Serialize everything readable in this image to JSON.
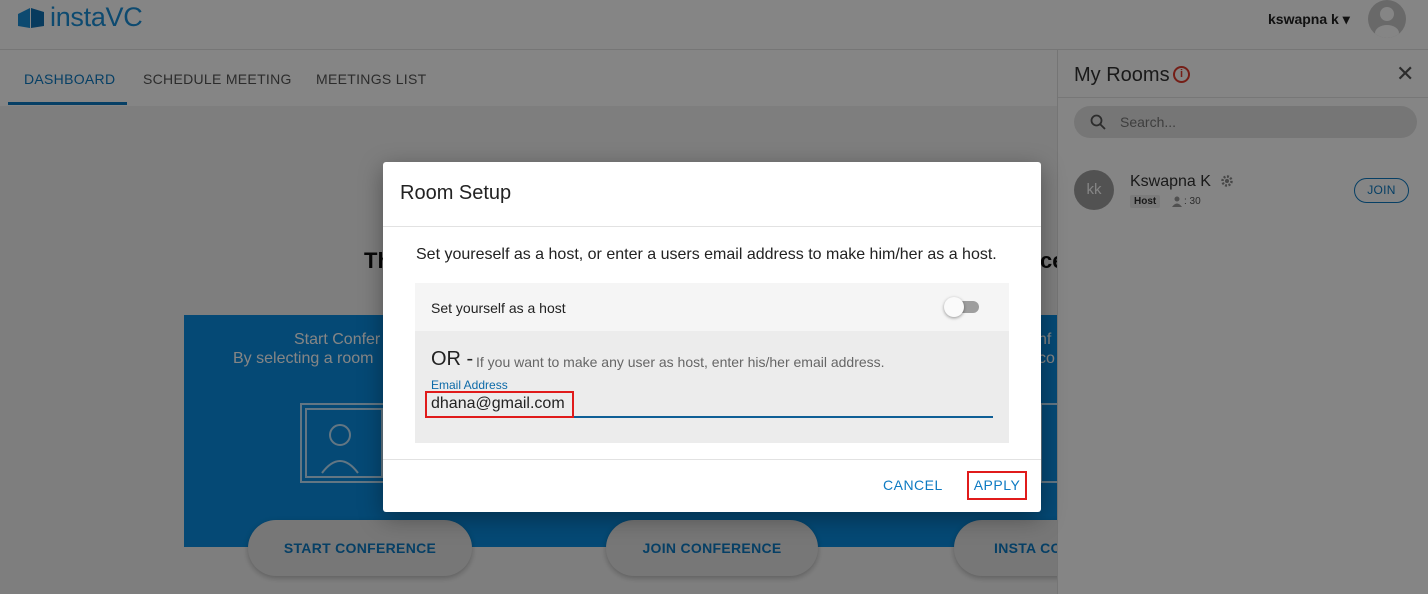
{
  "header": {
    "logo_text": "instaVC",
    "user_menu": "kswapna k ▾"
  },
  "tabs": [
    {
      "label": "DASHBOARD",
      "active": true
    },
    {
      "label": "SCHEDULE MEETING",
      "active": false
    },
    {
      "label": "MEETINGS LIST",
      "active": false
    }
  ],
  "dashboard": {
    "title_left": "Th",
    "title_right": "ce",
    "cards": [
      {
        "line1": "Start Confer",
        "line2": "By selecting a room"
      },
      {
        "line1": "",
        "line2": ""
      },
      {
        "line1": "nf",
        "line2": "co"
      }
    ],
    "buttons": [
      "START CONFERENCE",
      "JOIN CONFERENCE",
      "INSTA CO"
    ]
  },
  "rooms_panel": {
    "title": "My Rooms",
    "search_placeholder": "Search...",
    "rooms": [
      {
        "initials": "kk",
        "name": "Kswapna K",
        "role": "Host",
        "participants": ": 30",
        "join_label": "JOIN"
      }
    ]
  },
  "modal": {
    "title": "Room Setup",
    "instruction": "Set youreself as a host, or enter a users email address to make him/her as a host.",
    "host_toggle_label": "Set yourself as a host",
    "host_toggle_on": false,
    "or_label": "OR -",
    "or_hint": "If you want to make any user as host, enter his/her email address.",
    "email_label": "Email Address",
    "email_value": "dhana@gmail.com",
    "cancel_label": "CANCEL",
    "apply_label": "APPLY"
  },
  "colors": {
    "accent": "#0d7ac2",
    "card_blue": "#0a8de0",
    "highlight_red": "#e01b1b",
    "overlay": "rgba(0,0,0,0.48)"
  }
}
